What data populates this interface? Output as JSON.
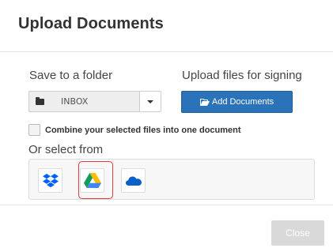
{
  "modal": {
    "title": "Upload Documents"
  },
  "save_folder": {
    "label": "Save to a folder",
    "selected": "INBOX"
  },
  "upload": {
    "label": "Upload files for signing",
    "button_label": "Add Documents"
  },
  "combine": {
    "label": "Combine your selected files into one document",
    "checked": false
  },
  "providers": {
    "label": "Or select from",
    "items": [
      {
        "name": "dropbox",
        "icon": "dropbox-icon",
        "color": "#0061fe"
      },
      {
        "name": "google-drive",
        "icon": "google-drive-icon",
        "highlighted": true
      },
      {
        "name": "onedrive",
        "icon": "onedrive-icon",
        "color": "#0a5fc8"
      }
    ]
  },
  "footer": {
    "close_label": "Close"
  },
  "colors": {
    "primary": "#2a73b8",
    "highlight": "#e03a3a",
    "disabled": "#d9d9d9"
  }
}
